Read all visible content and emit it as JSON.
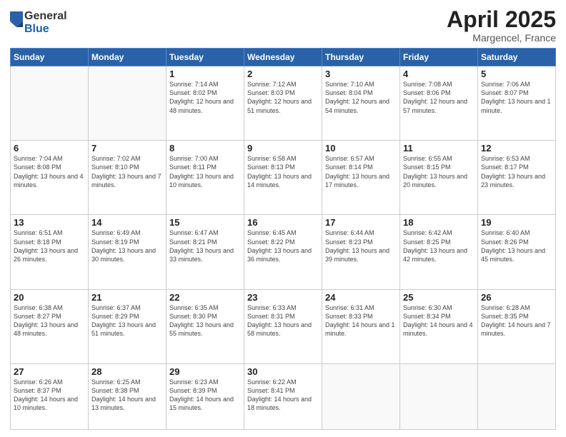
{
  "header": {
    "logo_general": "General",
    "logo_blue": "Blue",
    "title": "April 2025",
    "location": "Margencel, France"
  },
  "weekdays": [
    "Sunday",
    "Monday",
    "Tuesday",
    "Wednesday",
    "Thursday",
    "Friday",
    "Saturday"
  ],
  "weeks": [
    [
      {
        "day": "",
        "info": ""
      },
      {
        "day": "",
        "info": ""
      },
      {
        "day": "1",
        "info": "Sunrise: 7:14 AM\nSunset: 8:02 PM\nDaylight: 12 hours and 48 minutes."
      },
      {
        "day": "2",
        "info": "Sunrise: 7:12 AM\nSunset: 8:03 PM\nDaylight: 12 hours and 51 minutes."
      },
      {
        "day": "3",
        "info": "Sunrise: 7:10 AM\nSunset: 8:04 PM\nDaylight: 12 hours and 54 minutes."
      },
      {
        "day": "4",
        "info": "Sunrise: 7:08 AM\nSunset: 8:06 PM\nDaylight: 12 hours and 57 minutes."
      },
      {
        "day": "5",
        "info": "Sunrise: 7:06 AM\nSunset: 8:07 PM\nDaylight: 13 hours and 1 minute."
      }
    ],
    [
      {
        "day": "6",
        "info": "Sunrise: 7:04 AM\nSunset: 8:08 PM\nDaylight: 13 hours and 4 minutes."
      },
      {
        "day": "7",
        "info": "Sunrise: 7:02 AM\nSunset: 8:10 PM\nDaylight: 13 hours and 7 minutes."
      },
      {
        "day": "8",
        "info": "Sunrise: 7:00 AM\nSunset: 8:11 PM\nDaylight: 13 hours and 10 minutes."
      },
      {
        "day": "9",
        "info": "Sunrise: 6:58 AM\nSunset: 8:13 PM\nDaylight: 13 hours and 14 minutes."
      },
      {
        "day": "10",
        "info": "Sunrise: 6:57 AM\nSunset: 8:14 PM\nDaylight: 13 hours and 17 minutes."
      },
      {
        "day": "11",
        "info": "Sunrise: 6:55 AM\nSunset: 8:15 PM\nDaylight: 13 hours and 20 minutes."
      },
      {
        "day": "12",
        "info": "Sunrise: 6:53 AM\nSunset: 8:17 PM\nDaylight: 13 hours and 23 minutes."
      }
    ],
    [
      {
        "day": "13",
        "info": "Sunrise: 6:51 AM\nSunset: 8:18 PM\nDaylight: 13 hours and 26 minutes."
      },
      {
        "day": "14",
        "info": "Sunrise: 6:49 AM\nSunset: 8:19 PM\nDaylight: 13 hours and 30 minutes."
      },
      {
        "day": "15",
        "info": "Sunrise: 6:47 AM\nSunset: 8:21 PM\nDaylight: 13 hours and 33 minutes."
      },
      {
        "day": "16",
        "info": "Sunrise: 6:45 AM\nSunset: 8:22 PM\nDaylight: 13 hours and 36 minutes."
      },
      {
        "day": "17",
        "info": "Sunrise: 6:44 AM\nSunset: 8:23 PM\nDaylight: 13 hours and 39 minutes."
      },
      {
        "day": "18",
        "info": "Sunrise: 6:42 AM\nSunset: 8:25 PM\nDaylight: 13 hours and 42 minutes."
      },
      {
        "day": "19",
        "info": "Sunrise: 6:40 AM\nSunset: 8:26 PM\nDaylight: 13 hours and 45 minutes."
      }
    ],
    [
      {
        "day": "20",
        "info": "Sunrise: 6:38 AM\nSunset: 8:27 PM\nDaylight: 13 hours and 48 minutes."
      },
      {
        "day": "21",
        "info": "Sunrise: 6:37 AM\nSunset: 8:29 PM\nDaylight: 13 hours and 51 minutes."
      },
      {
        "day": "22",
        "info": "Sunrise: 6:35 AM\nSunset: 8:30 PM\nDaylight: 13 hours and 55 minutes."
      },
      {
        "day": "23",
        "info": "Sunrise: 6:33 AM\nSunset: 8:31 PM\nDaylight: 13 hours and 58 minutes."
      },
      {
        "day": "24",
        "info": "Sunrise: 6:31 AM\nSunset: 8:33 PM\nDaylight: 14 hours and 1 minute."
      },
      {
        "day": "25",
        "info": "Sunrise: 6:30 AM\nSunset: 8:34 PM\nDaylight: 14 hours and 4 minutes."
      },
      {
        "day": "26",
        "info": "Sunrise: 6:28 AM\nSunset: 8:35 PM\nDaylight: 14 hours and 7 minutes."
      }
    ],
    [
      {
        "day": "27",
        "info": "Sunrise: 6:26 AM\nSunset: 8:37 PM\nDaylight: 14 hours and 10 minutes."
      },
      {
        "day": "28",
        "info": "Sunrise: 6:25 AM\nSunset: 8:38 PM\nDaylight: 14 hours and 13 minutes."
      },
      {
        "day": "29",
        "info": "Sunrise: 6:23 AM\nSunset: 8:39 PM\nDaylight: 14 hours and 15 minutes."
      },
      {
        "day": "30",
        "info": "Sunrise: 6:22 AM\nSunset: 8:41 PM\nDaylight: 14 hours and 18 minutes."
      },
      {
        "day": "",
        "info": ""
      },
      {
        "day": "",
        "info": ""
      },
      {
        "day": "",
        "info": ""
      }
    ]
  ]
}
